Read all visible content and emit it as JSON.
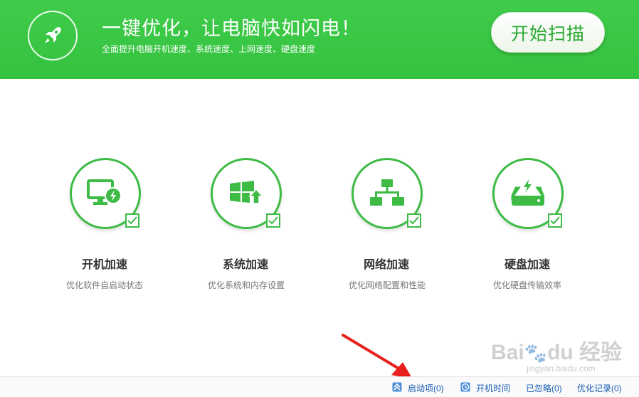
{
  "header": {
    "headline": "一键优化，让电脑快如闪电！",
    "subline": "全面提升电脑开机速度、系统速度、上网速度、硬盘速度",
    "scan_button": "开始扫描",
    "logo_icon": "rocket-icon"
  },
  "features": [
    {
      "title": "开机加速",
      "desc": "优化软件自启动状态",
      "icon": "monitor-bolt-icon",
      "checked": true
    },
    {
      "title": "系统加速",
      "desc": "优化系统和内存设置",
      "icon": "windows-up-icon",
      "checked": true
    },
    {
      "title": "网络加速",
      "desc": "优化网络配置和性能",
      "icon": "network-icon",
      "checked": true
    },
    {
      "title": "硬盘加速",
      "desc": "优化硬盘传输效率",
      "icon": "harddisk-bolt-icon",
      "checked": true
    }
  ],
  "footer": {
    "startup": "启动项(0)",
    "boot_time": "开机时间",
    "ignored": "已忽略(0)",
    "history": "优化记录(0)"
  },
  "watermark": {
    "brand": "Bai",
    "brand_suffix": "du 经验",
    "url": "jingyan.baidu.com"
  },
  "colors": {
    "accent": "#3dbb45",
    "header": "#38c543",
    "link": "#1a5fb4",
    "arrow": "#e8201d"
  }
}
